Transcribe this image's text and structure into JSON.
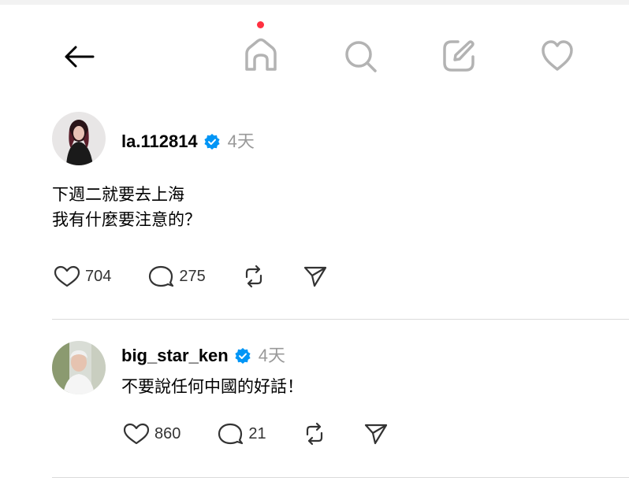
{
  "nav": {
    "back_icon": "arrow-left-icon",
    "home_icon": "home-icon",
    "search_icon": "search-icon",
    "compose_icon": "compose-icon",
    "activity_icon": "heart-icon",
    "notification_dot_color": "#ff3040"
  },
  "posts": [
    {
      "username": "la.112814",
      "verified": true,
      "time": "4天",
      "lines": [
        "下週二就要去上海",
        "我有什麼要注意的？"
      ],
      "likes": "704",
      "replies": "275"
    },
    {
      "username": "big_star_ken",
      "verified": true,
      "time": "4天",
      "lines": [
        "不要說任何中國的好話！"
      ],
      "likes": "860",
      "replies": "21"
    }
  ],
  "colors": {
    "verified": "#0095f6",
    "muted": "#999999",
    "divider": "#dbdbdb"
  }
}
